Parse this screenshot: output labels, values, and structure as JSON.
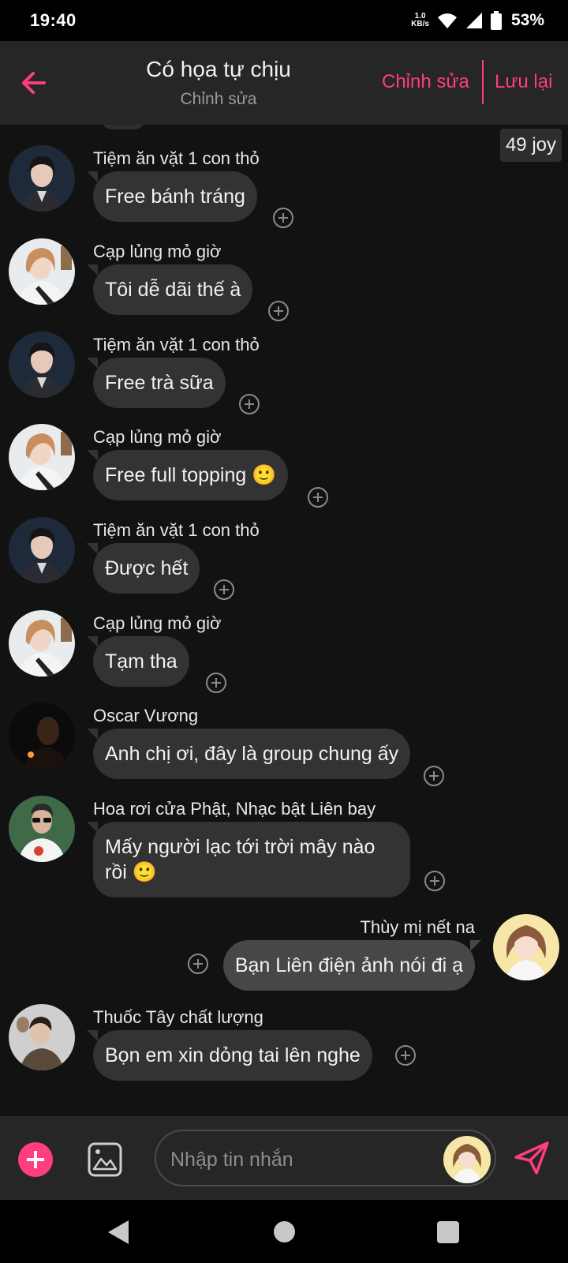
{
  "status_bar": {
    "time": "19:40",
    "net_speed_value": "1.0",
    "net_speed_unit": "KB/s",
    "battery": "53%",
    "icons": [
      "wifi-icon",
      "signal-icon",
      "battery-icon"
    ]
  },
  "header": {
    "title": "Có họa tự chịu",
    "subtitle": "Chỉnh sửa",
    "edit_label": "Chỉnh sửa",
    "save_label": "Lưu lại",
    "back_icon": "back-arrow-icon"
  },
  "chat": {
    "joy_badge": "49 joy",
    "messages": [
      {
        "sender": "Tiệm ăn vặt 1 con thỏ",
        "text": "Free bánh tráng",
        "side": "left"
      },
      {
        "sender": "Cạp lủng mỏ giờ",
        "text": "Tôi dễ dãi thế à",
        "side": "left"
      },
      {
        "sender": "Tiệm ăn vặt 1 con thỏ",
        "text": "Free trà sữa",
        "side": "left"
      },
      {
        "sender": "Cạp lủng mỏ giờ",
        "text": "Free full topping 🙂",
        "side": "left"
      },
      {
        "sender": "Tiệm ăn vặt 1 con thỏ",
        "text": "Được hết",
        "side": "left"
      },
      {
        "sender": "Cạp lủng mỏ giờ",
        "text": "Tạm tha",
        "side": "left"
      },
      {
        "sender": "Oscar Vương",
        "text": "Anh chị ơi, đây là group chung ấy",
        "side": "left"
      },
      {
        "sender": "Hoa rơi cửa Phật, Nhạc bật Liên bay",
        "text": "Mấy người lạc tới trời mây nào rồi 🙂",
        "side": "left"
      },
      {
        "sender": "Thùy mị nết na",
        "text": "Bạn Liên điện ảnh nói đi ạ",
        "side": "right"
      },
      {
        "sender": "Thuốc Tây chất lượng",
        "text": "Bọn em xin dỏng tai lên nghe",
        "side": "left"
      }
    ]
  },
  "input_bar": {
    "placeholder": "Nhập tin nhắn",
    "value": "",
    "icons": [
      "add-icon",
      "image-icon",
      "send-icon"
    ],
    "accent_color": "#ff3d7f"
  },
  "nav_bar": {
    "icons": [
      "nav-back-icon",
      "nav-home-icon",
      "nav-recents-icon"
    ]
  }
}
